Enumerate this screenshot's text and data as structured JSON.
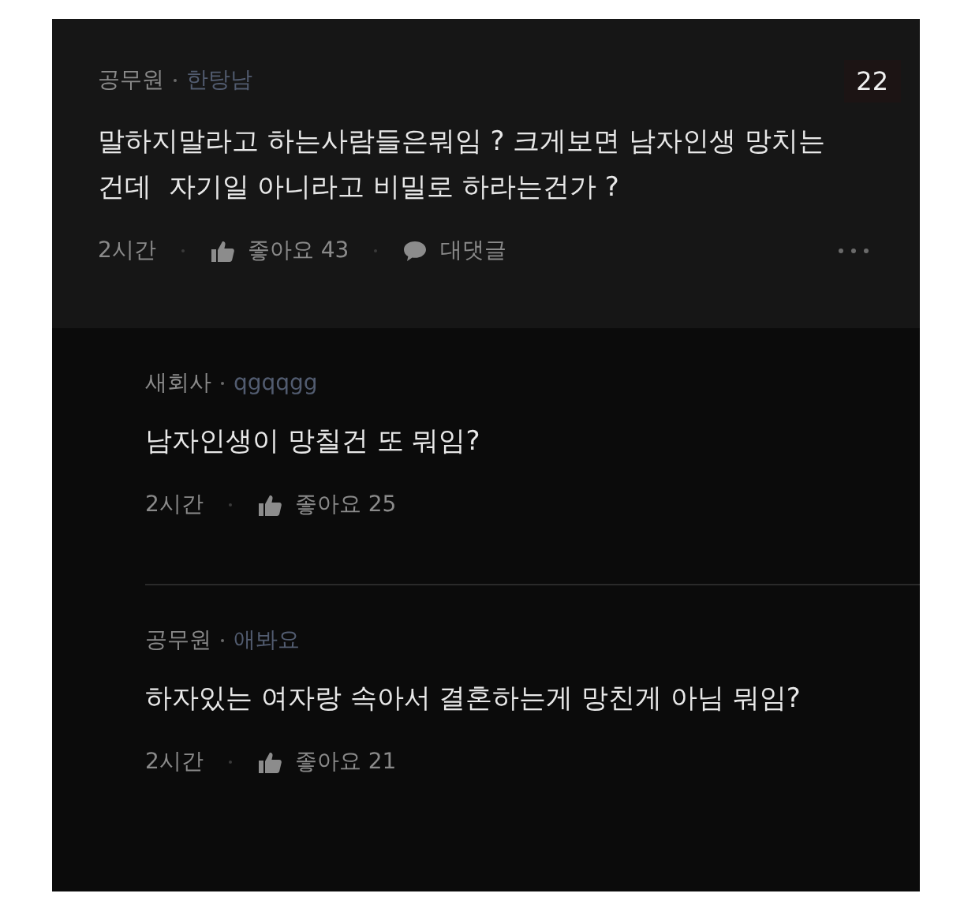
{
  "comment": {
    "affiliation": "공무원",
    "nickname": "한탕남",
    "badge": "22",
    "body": "말하지말라고 하는사람들은뭐임 ? 크게보면 남자인생 망치는건데  자기일 아니라고 비밀로 하라는건가 ?",
    "time": "2시간",
    "like_label": "좋아요 43",
    "reply_label": "대댓글"
  },
  "replies": [
    {
      "affiliation": "새회사",
      "nickname": "qgqqgg",
      "body": "남자인생이 망칠건 또 뭐임?",
      "time": "2시간",
      "like_label": "좋아요 25"
    },
    {
      "affiliation": "공무원",
      "nickname": "애봐요",
      "body": "하자있는 여자랑 속아서 결혼하는게 망친게 아님 뭐임?",
      "time": "2시간",
      "like_label": "좋아요 21"
    }
  ]
}
